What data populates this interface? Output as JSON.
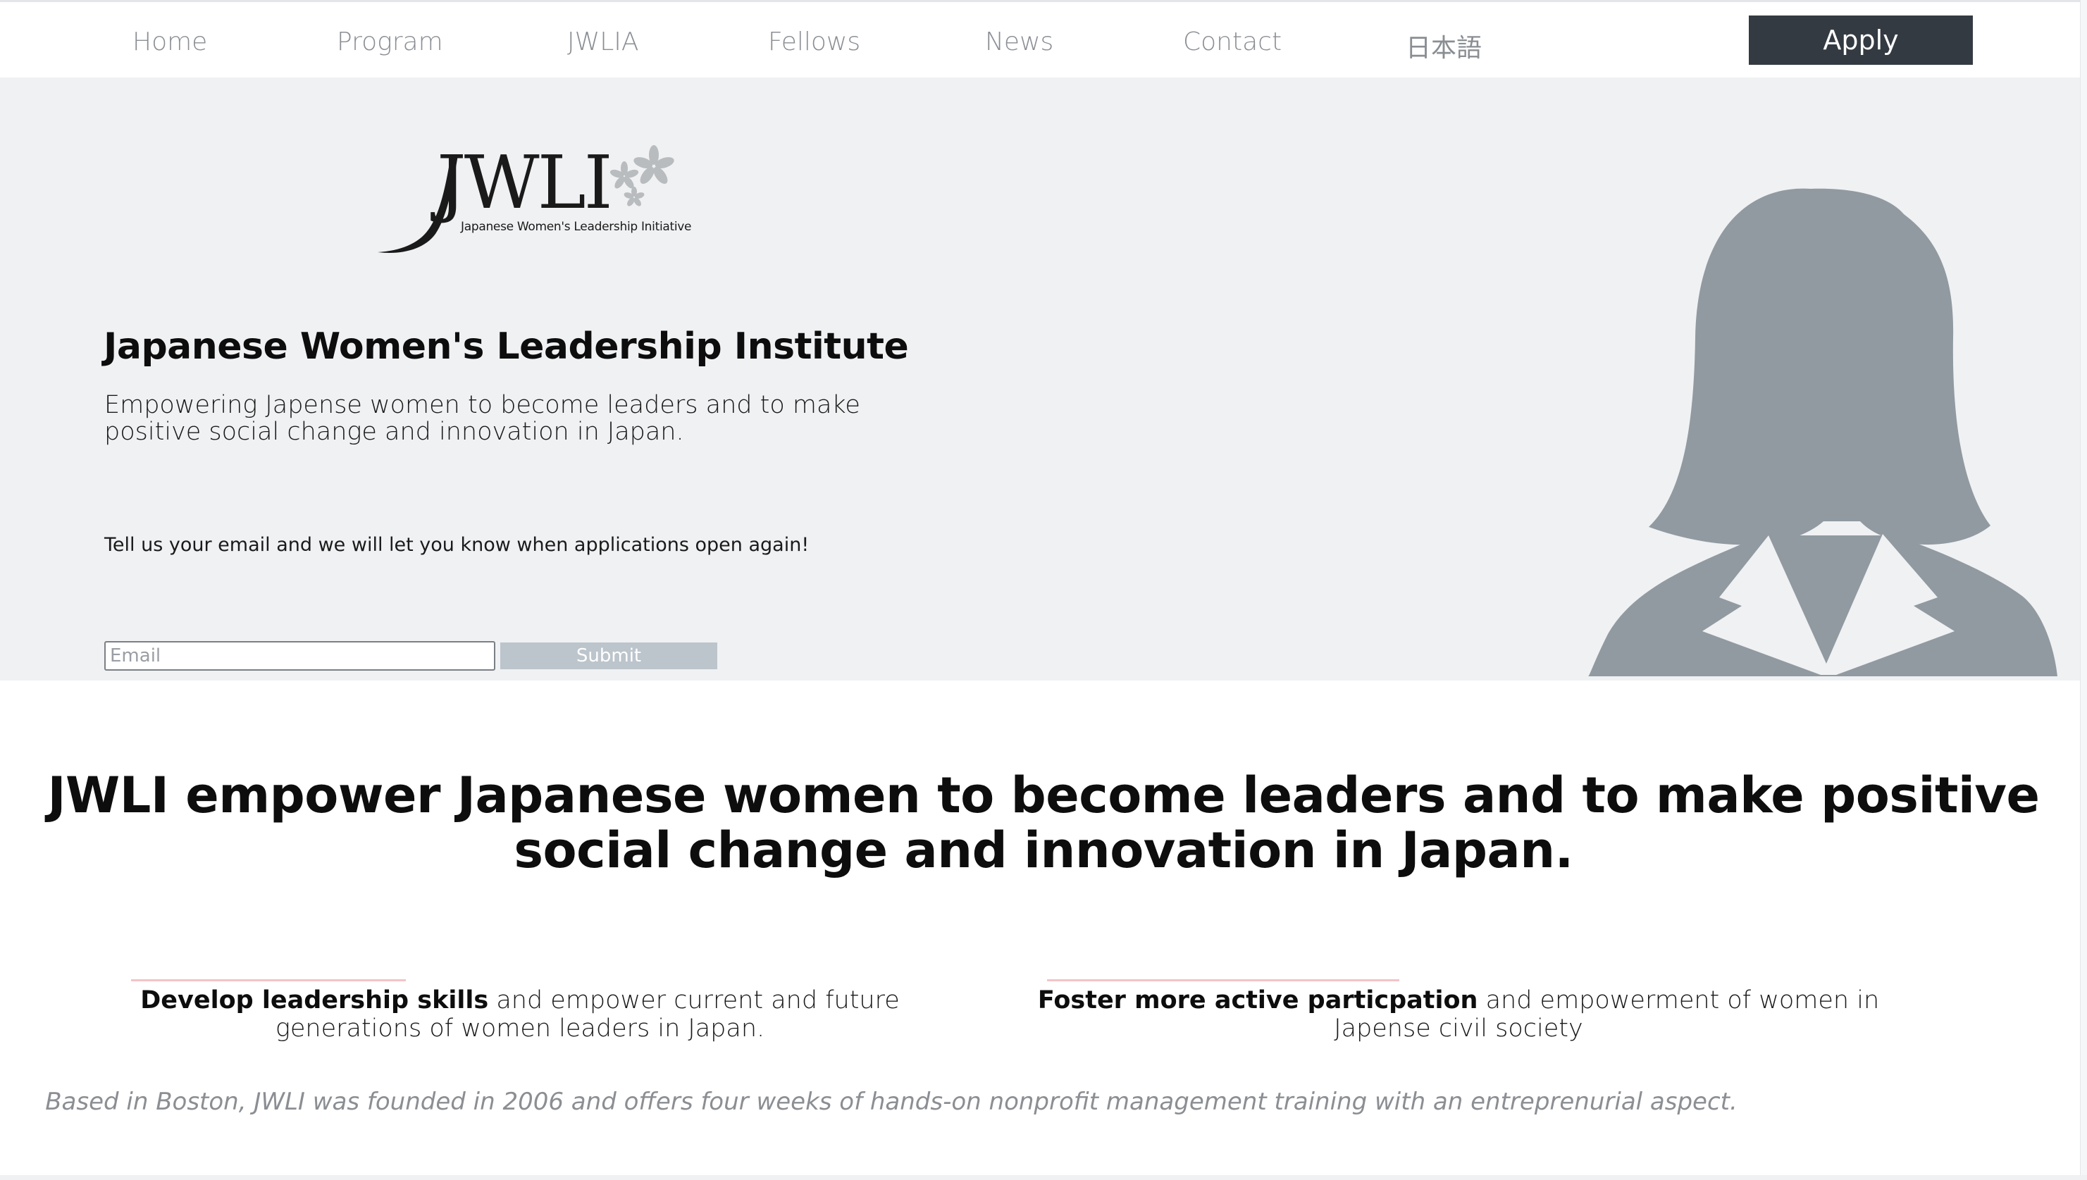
{
  "nav": {
    "items": [
      {
        "label": "Home"
      },
      {
        "label": "Program"
      },
      {
        "label": "JWLIA"
      },
      {
        "label": "Fellows"
      },
      {
        "label": "News"
      },
      {
        "label": "Contact"
      },
      {
        "label": "日本語"
      }
    ],
    "apply_label": "Apply"
  },
  "hero": {
    "logo_text": "JWLI",
    "logo_subtext": "Japanese Women's Leadership Initiative",
    "title": "Japanese Women's Leadership Institute",
    "subtitle": "Empowering Japense women to become leaders and to make positive social change and innovation in Japan.",
    "notify_text": "Tell us your email and we will let you know when applications open again!",
    "email_placeholder": "Email",
    "submit_label": "Submit"
  },
  "mission": {
    "headline": "JWLI empower Japanese women to become leaders and to make positive social change and innovation in Japan.",
    "goals": [
      {
        "bold": "Develop leadership skills",
        "rest": " and empower current and future generations of women leaders in Japan."
      },
      {
        "bold": "Foster more active particpation",
        "rest": " and empowerment of women in Japense civil society"
      }
    ],
    "founded": "Based in Boston, JWLI was founded in 2006 and offers four weeks of hands-on nonprofit management training with an entreprenurial aspect."
  },
  "colors": {
    "hero_bg": "#f0f1f3",
    "apply_bg": "#343a42",
    "submit_bg": "#bcc4cc",
    "silhouette": "#919aa1",
    "accent_line": "#f3c4c7"
  }
}
